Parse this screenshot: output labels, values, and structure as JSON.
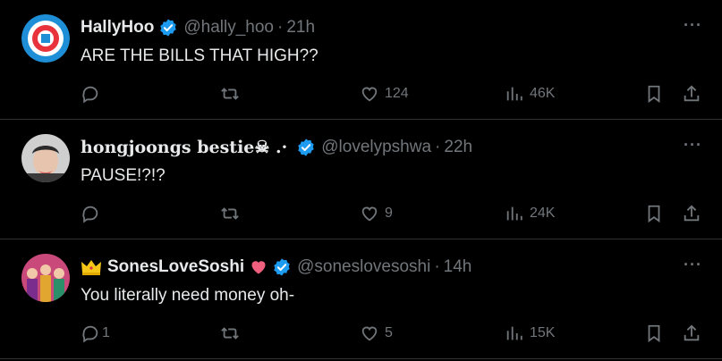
{
  "tweets": [
    {
      "name": "HallyHoo",
      "handle": "@hally_hoo",
      "dot": "·",
      "time": "21h",
      "text": "ARE THE BILLS THAT HIGH??",
      "replies": "",
      "likes": "124",
      "views": "46K",
      "more": "···"
    },
    {
      "name": "hongjoongs bestie☠︎ .·",
      "handle": "@lovelypshwa",
      "dot": "·",
      "time": "22h",
      "text": "PAUSE!?!?",
      "replies": "",
      "likes": "9",
      "views": "24K",
      "more": "···"
    },
    {
      "name": "SonesLoveSoshi",
      "handle": "@soneslovesoshi",
      "dot": "·",
      "time": "14h",
      "text": "You literally need money oh-",
      "replies": "1",
      "likes": "5",
      "views": "15K",
      "more": "···"
    }
  ],
  "colors": {
    "verified": "#1d9bf0",
    "muted": "#71767b",
    "text": "#e7e9ea",
    "background": "#000000",
    "divider": "#2f3336"
  }
}
